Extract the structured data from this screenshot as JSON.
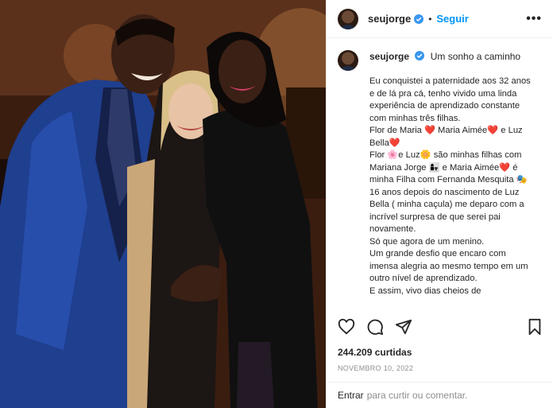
{
  "post": {
    "username": "seujorge",
    "follow_label": "Seguir",
    "more_label": "•••",
    "caption_title": "Um sonho a caminho",
    "caption_body": "Eu conquistei a paternidade aos 32 anos e de lá pra cá, tenho vivido uma linda experiência de aprendizado constante com minhas três filhas.\nFlor de Maria ❤️ Maria Aimée❤️ e Luz Bella❤️\nFlor 🌸e Luz🌼 são minhas filhas com Mariana Jorge 👩‍👧 e Maria Aimée❤️ é minha Filha com Fernanda Mesquita 🎭\n16 anos depois do nascimento de Luz Bella ( minha caçula) me deparo com a incrível surpresa de que serei pai novamente.\nSó que agora de um menino.\nUm grande desfio que encaro com imensa alegria ao mesmo tempo em um outro nível de aprendizado.\nE assim, vivo dias cheios de",
    "likes": "244.209 curtidas",
    "date": "NOVEMBRO 10, 2022",
    "comment_link": "Entrar",
    "comment_rest": "para curtir ou comentar."
  },
  "icons": {
    "verified": "verified-badge-icon",
    "like": "heart-icon",
    "comment": "comment-icon",
    "share": "send-icon",
    "save": "bookmark-icon"
  },
  "colors": {
    "accent": "#0095f6",
    "text": "#262626",
    "muted": "#8e8e8e",
    "heart": "#ed4956"
  }
}
